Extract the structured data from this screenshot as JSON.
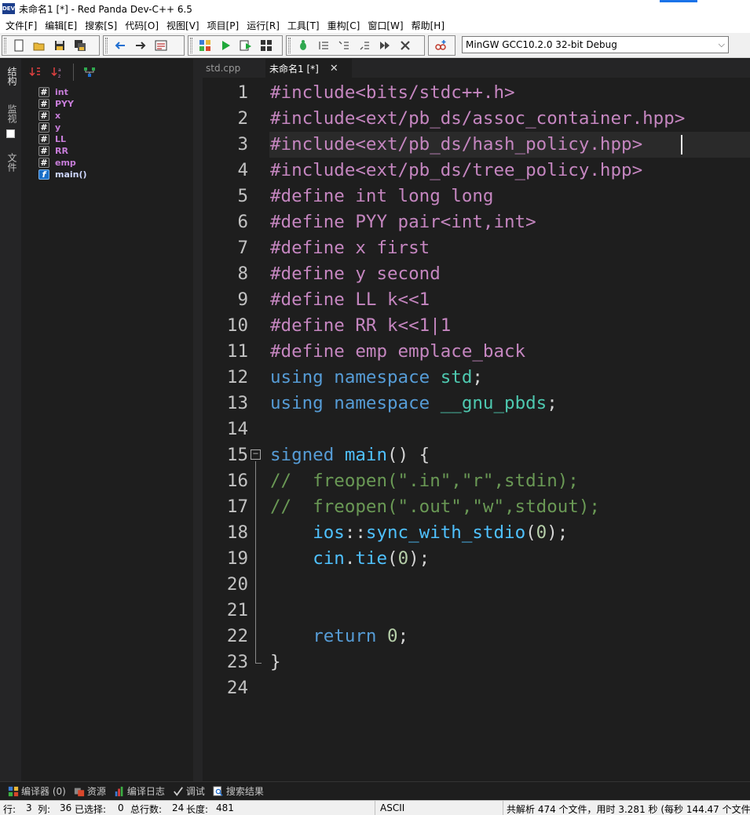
{
  "window": {
    "title": "未命名1 [*] - Red Panda Dev-C++ 6.5",
    "app_icon": "DEV"
  },
  "menu": [
    "文件[F]",
    "编辑[E]",
    "搜索[S]",
    "代码[O]",
    "视图[V]",
    "项目[P]",
    "运行[R]",
    "工具[T]",
    "重构[C]",
    "窗口[W]",
    "帮助[H]"
  ],
  "toolbar": {
    "compiler": "MinGW GCC10.2.0 32-bit Debug"
  },
  "left_tabs": [
    "结构",
    "监视",
    "文件"
  ],
  "class_browser": {
    "items": [
      {
        "icon": "#",
        "name": "int"
      },
      {
        "icon": "#",
        "name": "PYY"
      },
      {
        "icon": "#",
        "name": "x"
      },
      {
        "icon": "#",
        "name": "y"
      },
      {
        "icon": "#",
        "name": "LL"
      },
      {
        "icon": "#",
        "name": "RR"
      },
      {
        "icon": "#",
        "name": "emp"
      },
      {
        "icon": "f",
        "name": "main()"
      }
    ]
  },
  "editor_tabs": [
    {
      "label": "std.cpp",
      "active": false
    },
    {
      "label": "未命名1 [*]",
      "active": true,
      "close": "✕"
    }
  ],
  "line_numbers": [
    "1",
    "2",
    "3",
    "4",
    "5",
    "6",
    "7",
    "8",
    "9",
    "10",
    "11",
    "12",
    "13",
    "14",
    "15",
    "16",
    "17",
    "18",
    "19",
    "20",
    "21",
    "22",
    "23",
    "24"
  ],
  "code_lines": [
    "#include<bits/stdc++.h>",
    "#include<ext/pb_ds/assoc_container.hpp>",
    "#include<ext/pb_ds/hash_policy.hpp>",
    "#include<ext/pb_ds/tree_policy.hpp>",
    "#define int long long",
    "#define PYY pair<int,int>",
    "#define x first",
    "#define y second",
    "#define LL k<<1",
    "#define RR k<<1|1",
    "#define emp emplace_back",
    "using namespace std;",
    "using namespace __gnu_pbds;",
    "",
    "signed main() {",
    "//  freopen(\".in\",\"r\",stdin);",
    "//  freopen(\".out\",\"w\",stdout);",
    "    ios::sync_with_stdio(0);",
    "    cin.tie(0);",
    "",
    "",
    "    return 0;",
    "}",
    ""
  ],
  "bottom_tabs": [
    "编译器 (0)",
    "资源",
    "编译日志",
    "调试",
    "搜索结果"
  ],
  "status": {
    "line_label": "行:",
    "line": "3",
    "col_label": "列:",
    "col": "36",
    "sel_label": "已选择:",
    "sel": "0",
    "total_label": "总行数:",
    "total": "24",
    "len_label": "长度:",
    "len": "481",
    "encoding": "ASCII",
    "parse_info": "共解析 474 个文件，用时 3.281 秒 (每秒 144.47 个文件)"
  }
}
